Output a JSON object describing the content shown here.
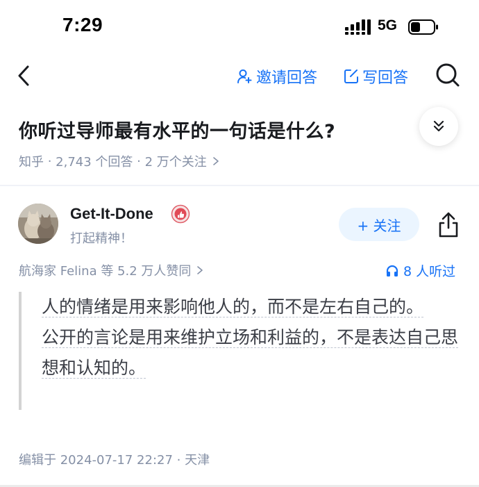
{
  "status_bar": {
    "time": "7:29",
    "network": "5G"
  },
  "nav": {
    "invite_label": "邀请回答",
    "write_label": "写回答"
  },
  "question": {
    "title": "你听过导师最有水平的一句话是什么?",
    "meta": {
      "source": "知乎",
      "answers": "2,743 个回答",
      "followers": "2 万个关注"
    }
  },
  "author": {
    "name": "Get-It-Done",
    "bio": "打起精神！",
    "follow_label": "+ 关注"
  },
  "engagement": {
    "likes": "航海家 Felina 等 5.2 万人赞同",
    "listeners": "8 人听过"
  },
  "answer": {
    "quote_lines": [
      "人的情绪是用来影响他人的，而不是左右自己的。",
      "公开的言论是用来维护立场和利益的，不是表达自己思想和认知的。"
    ]
  },
  "footer": {
    "edited": "编辑于 2024-07-17 22:27 · 天津"
  },
  "colors": {
    "accent": "#1772f6",
    "meta": "#8590a6",
    "follow_bg": "#ebf5ff"
  }
}
